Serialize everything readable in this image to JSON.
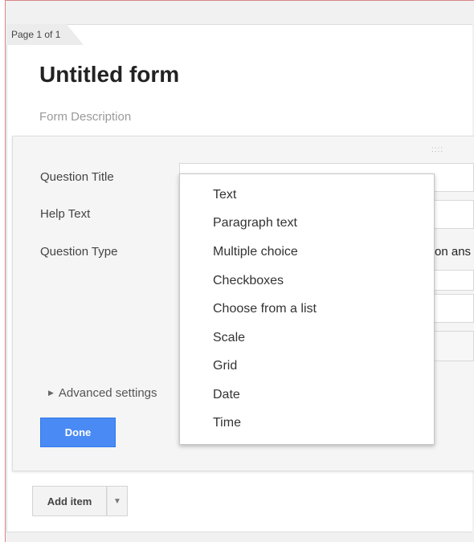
{
  "page_indicator": "Page 1 of 1",
  "form": {
    "title": "Untitled form",
    "description": "Form Description"
  },
  "question": {
    "drag_handle": "::::",
    "title_label": "Question Title",
    "help_label": "Help Text",
    "type_label": "Question Type",
    "type_value": "on ans",
    "advanced_label": "Advanced settings",
    "done_label": "Done"
  },
  "question_type_menu": {
    "items": [
      "Text",
      "Paragraph text",
      "Multiple choice",
      "Checkboxes",
      "Choose from a list",
      "Scale",
      "Grid",
      "Date",
      "Time"
    ]
  },
  "footer": {
    "add_item_label": "Add item"
  },
  "colors": {
    "done_button": "#4a8af4",
    "background": "#f1f1f1"
  }
}
